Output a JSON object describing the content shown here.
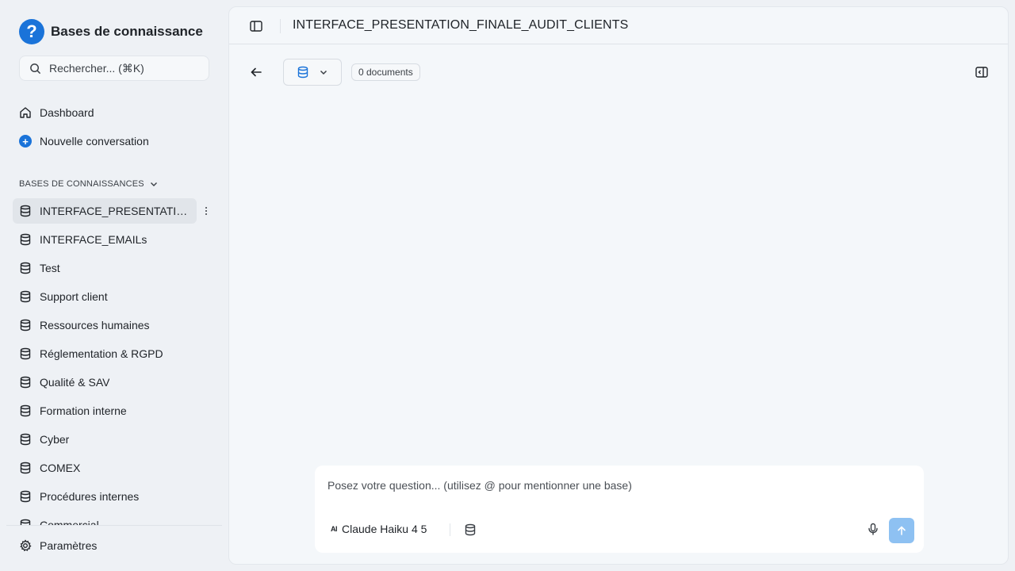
{
  "app": {
    "title": "Bases de connaissance",
    "logo_glyph": "?"
  },
  "search": {
    "placeholder": "Rechercher... (⌘K)"
  },
  "nav": {
    "dashboard": "Dashboard",
    "new_conversation": "Nouvelle conversation"
  },
  "section": {
    "label": "BASES DE CONNAISSANCES"
  },
  "knowledge_bases": [
    {
      "label": "INTERFACE_PRESENTATIO...",
      "active": true
    },
    {
      "label": "INTERFACE_EMAILs"
    },
    {
      "label": "Test"
    },
    {
      "label": "Support client"
    },
    {
      "label": "Ressources humaines"
    },
    {
      "label": "Réglementation & RGPD"
    },
    {
      "label": "Qualité & SAV"
    },
    {
      "label": "Formation interne"
    },
    {
      "label": "Cyber"
    },
    {
      "label": "COMEX"
    },
    {
      "label": "Procédures internes"
    },
    {
      "label": "Commercial"
    }
  ],
  "footer": {
    "settings": "Paramètres"
  },
  "header": {
    "title": "INTERFACE_PRESENTATION_FINALE_AUDIT_CLIENTS"
  },
  "toolbar": {
    "documents_badge": "0 documents"
  },
  "composer": {
    "placeholder": "Posez votre question... (utilisez @ pour mentionner une base)",
    "model_label": "Claude Haiku 4 5",
    "model_icon_text": "AI"
  },
  "colors": {
    "accent": "#1a73d9",
    "send_button": "#8ec1f2",
    "background": "#eef1f5"
  }
}
